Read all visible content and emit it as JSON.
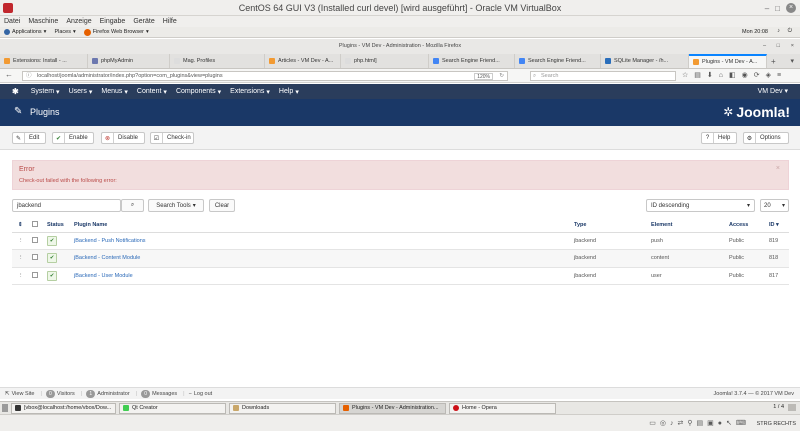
{
  "vbox": {
    "title": "CentOS 64 GUI V3 (Installed curl devel) [wird ausgeführt] - Oracle VM VirtualBox",
    "menu": [
      "Datei",
      "Maschine",
      "Anzeige",
      "Eingabe",
      "Geräte",
      "Hilfe"
    ],
    "host_key": "STRG RECHTS"
  },
  "gnome": {
    "applications": "Applications",
    "places": "Places",
    "browser": "Firefox Web Browser",
    "clock": "Mon 20:08"
  },
  "firefox": {
    "window_title": "Plugins - VM Dev - Administration - Mozilla Firefox",
    "tabs": [
      {
        "label": "Extensions: Install - ..."
      },
      {
        "label": "phpMyAdmin"
      },
      {
        "label": "Mag. Profiles"
      },
      {
        "label": "Articles - VM Dev - A..."
      },
      {
        "label": "php.html]"
      },
      {
        "label": "Search Engine Friend..."
      },
      {
        "label": "Search Engine Friend..."
      },
      {
        "label": "SQLite Manager - /h..."
      },
      {
        "label": "Plugins - VM Dev - A..."
      }
    ],
    "url": "localhost/joomla/administrator/index.php?option=com_plugins&view=plugins",
    "zoom": "120%",
    "search_placeholder": "Search"
  },
  "joomla": {
    "menu": [
      "System",
      "Users",
      "Menus",
      "Content",
      "Components",
      "Extensions",
      "Help"
    ],
    "site_name": "VM Dev",
    "page_title": "Plugins",
    "logo_text": "Joomla!",
    "toolbar": {
      "edit": "Edit",
      "enable": "Enable",
      "disable": "Disable",
      "checkin": "Check-in",
      "help": "Help",
      "options": "Options"
    },
    "alert": {
      "heading": "Error",
      "message": "Check-out failed with the following error:"
    },
    "filters": {
      "search_value": "jbackend",
      "search_tools": "Search Tools",
      "clear": "Clear",
      "ordering": "ID descending",
      "limit": "20"
    },
    "table": {
      "headers": {
        "status": "Status",
        "name": "Plugin Name",
        "type": "Type",
        "element": "Element",
        "access": "Access",
        "id": "ID"
      },
      "rows": [
        {
          "name": "jBackend - Push Notifications",
          "type": "jbackend",
          "element": "push",
          "access": "Public",
          "id": "819"
        },
        {
          "name": "jBackend - Content Module",
          "type": "jbackend",
          "element": "content",
          "access": "Public",
          "id": "818"
        },
        {
          "name": "jBackend - User Module",
          "type": "jbackend",
          "element": "user",
          "access": "Public",
          "id": "817"
        }
      ]
    },
    "status_bar": {
      "view_site": "View Site",
      "visitors_count": "0",
      "visitors": "Visitors",
      "admin_count": "1",
      "administrator": "Administrator",
      "messages_count": "0",
      "messages": "Messages",
      "logout": "Log out",
      "version": "Joomla! 3.7.4 — © 2017 VM Dev"
    }
  },
  "taskbar": {
    "items": [
      {
        "label": "[vbox@localhost:/home/vbox/Dow..."
      },
      {
        "label": "Qt Creator"
      },
      {
        "label": "Downloads"
      },
      {
        "label": "Plugins - VM Dev - Administration..."
      },
      {
        "label": "Home - Opera"
      }
    ],
    "workspace": "1 / 4"
  }
}
